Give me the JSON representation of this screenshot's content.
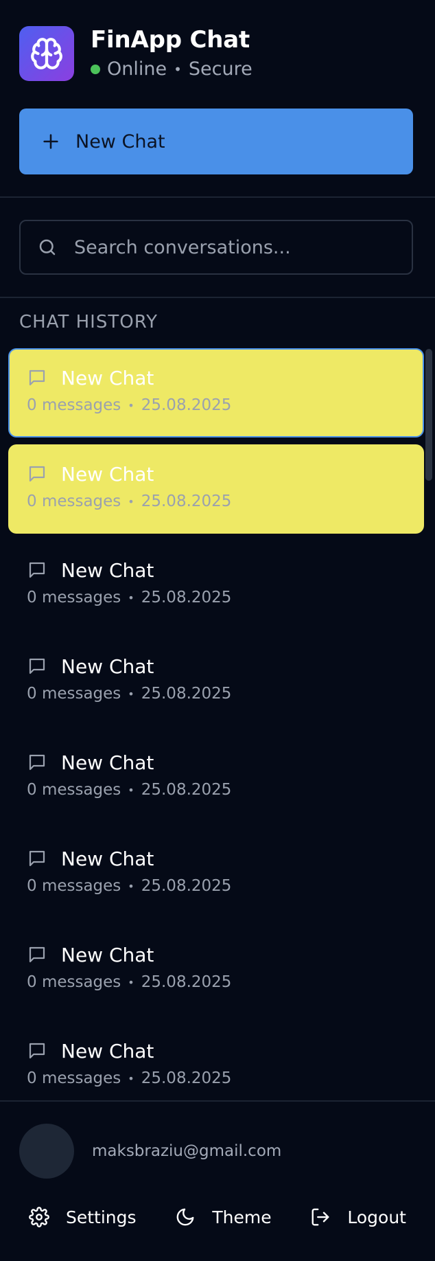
{
  "app": {
    "title": "FinApp Chat",
    "status_online": "Online",
    "status_separator": "•",
    "status_secure": "Secure",
    "logo_icon": "brain-icon",
    "status_color": "#4cc25a"
  },
  "new_chat_button": {
    "label": "New Chat",
    "icon": "plus-icon",
    "color": "#4a90e8"
  },
  "search": {
    "placeholder": "Search conversations...",
    "value": "",
    "icon": "search-icon"
  },
  "history": {
    "title": "CHAT HISTORY",
    "items": [
      {
        "title": "New Chat",
        "messages": "0 messages",
        "date": "25.08.2025",
        "state": "active"
      },
      {
        "title": "New Chat",
        "messages": "0 messages",
        "date": "25.08.2025",
        "state": "hover"
      },
      {
        "title": "New Chat",
        "messages": "0 messages",
        "date": "25.08.2025",
        "state": "normal"
      },
      {
        "title": "New Chat",
        "messages": "0 messages",
        "date": "25.08.2025",
        "state": "normal"
      },
      {
        "title": "New Chat",
        "messages": "0 messages",
        "date": "25.08.2025",
        "state": "normal"
      },
      {
        "title": "New Chat",
        "messages": "0 messages",
        "date": "25.08.2025",
        "state": "normal"
      },
      {
        "title": "New Chat",
        "messages": "0 messages",
        "date": "25.08.2025",
        "state": "normal"
      },
      {
        "title": "New Chat",
        "messages": "0 messages",
        "date": "25.08.2025",
        "state": "normal"
      }
    ],
    "highlight_color": "#eee965"
  },
  "user": {
    "email": "maksbraziu@gmail.com"
  },
  "footer": {
    "settings_label": "Settings",
    "theme_label": "Theme",
    "logout_label": "Logout"
  }
}
